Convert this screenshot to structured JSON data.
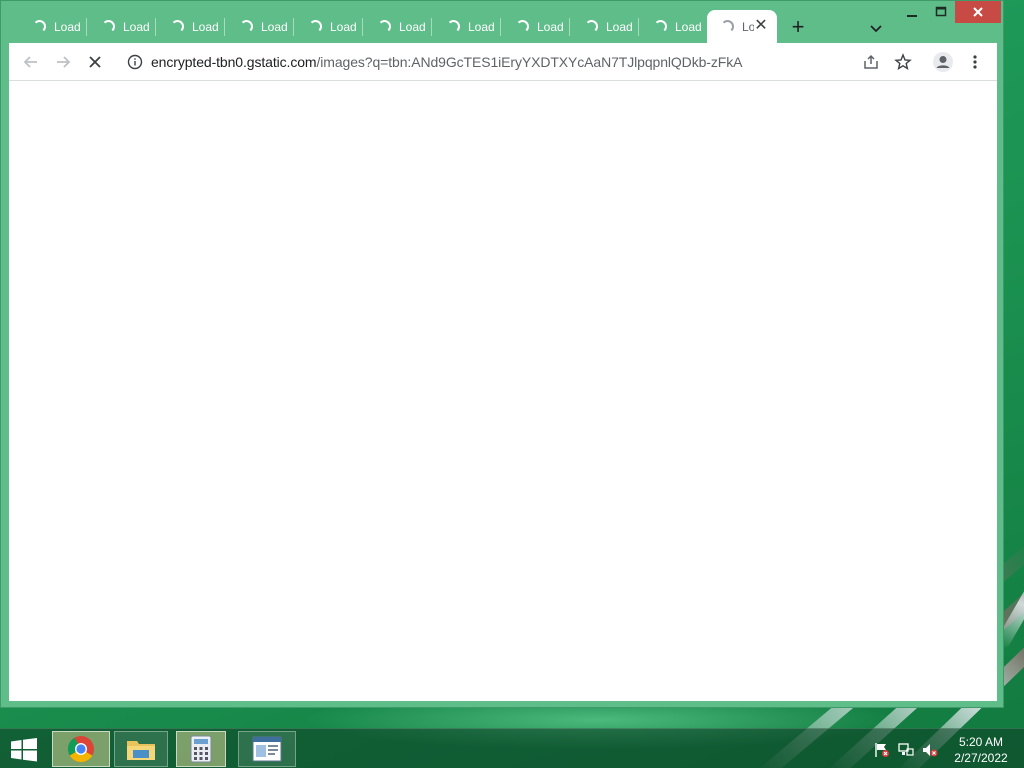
{
  "browser": {
    "tabs": [
      {
        "title": "Loading"
      },
      {
        "title": "Loading"
      },
      {
        "title": "Loading"
      },
      {
        "title": "Loading"
      },
      {
        "title": "Loading"
      },
      {
        "title": "Loading"
      },
      {
        "title": "Loading"
      },
      {
        "title": "Loading"
      },
      {
        "title": "Loading"
      },
      {
        "title": "Loading"
      }
    ],
    "active_tab": {
      "title": "Loading"
    },
    "new_tab_label": "+",
    "close_tab_label": "✕",
    "address": {
      "host": "encrypted-tbn0.gstatic.com",
      "path": "/images?q=tbn:ANd9GcTES1iEryYXDTXYcAaN7TJlpqpnlQDkb-zFkA"
    },
    "colors": {
      "frame": "#5fbd8a",
      "close_button": "#c74a44",
      "content": "#ffffff"
    }
  },
  "taskbar": {
    "apps": [
      {
        "name": "Google Chrome",
        "icon": "chrome-icon",
        "active": true
      },
      {
        "name": "File Explorer",
        "icon": "folder-icon",
        "active": false
      },
      {
        "name": "Calculator",
        "icon": "calculator-icon",
        "active": true
      },
      {
        "name": "Window",
        "icon": "window-app-icon",
        "active": false
      }
    ],
    "tray": [
      "action-center-flag-icon",
      "network-icon",
      "volume-muted-icon"
    ],
    "clock": {
      "time": "5:20 AM",
      "date": "2/27/2022"
    }
  }
}
